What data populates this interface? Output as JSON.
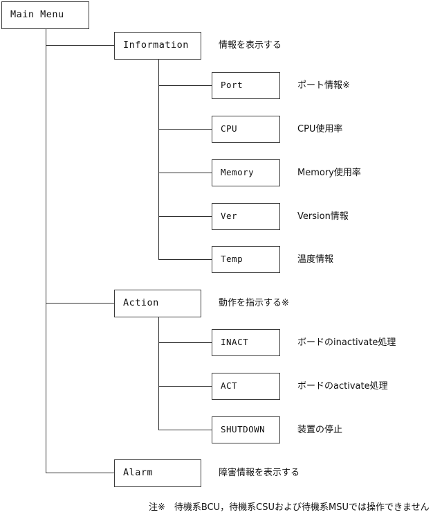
{
  "diagram": {
    "title": "Main Menu tree",
    "line_color": "#2e2e2e",
    "border_color": "#3a3a3a",
    "background": "#ffffff"
  },
  "nodes": {
    "root": {
      "label": "Main Menu"
    },
    "information": {
      "label": "Information",
      "desc": "情報を表示する"
    },
    "port": {
      "label": "Port",
      "desc": "ポート情報※"
    },
    "cpu": {
      "label": "CPU",
      "desc": "CPU使用率"
    },
    "memory": {
      "label": "Memory",
      "desc": "Memory使用率"
    },
    "ver": {
      "label": "Ver",
      "desc": "Version情報"
    },
    "temp": {
      "label": "Temp",
      "desc": "温度情報"
    },
    "action": {
      "label": "Action",
      "desc": "動作を指示する※"
    },
    "inact": {
      "label": "INACT",
      "desc": "ボードのinactivate処理"
    },
    "act": {
      "label": "ACT",
      "desc": "ボードのactivate処理"
    },
    "shutdown": {
      "label": "SHUTDOWN",
      "desc": "装置の停止"
    },
    "alarm": {
      "label": "Alarm",
      "desc": "障害情報を表示する"
    }
  },
  "footnote": {
    "text": "注※　待機系BCU，待機系CSUおよび待機系MSUでは操作できません"
  }
}
